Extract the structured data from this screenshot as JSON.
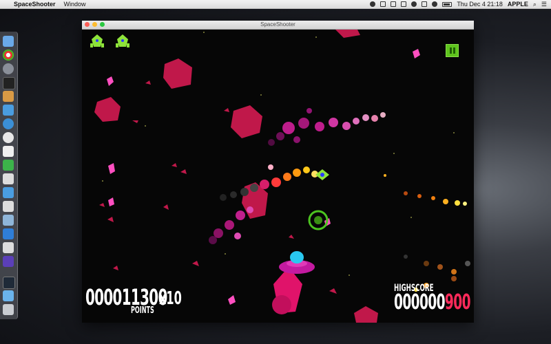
{
  "menubar": {
    "app_name": "SpaceShooter",
    "menu_window": "Window",
    "clock": "Thu Dec 4  21:18",
    "user": "APPLE"
  },
  "window": {
    "title": "SpaceShooter"
  },
  "hud": {
    "score": "000011300",
    "multiplier": "x10",
    "points_label": "POINTS",
    "highscore_label": "HIGHSCORE",
    "highscore_prefix": "000000",
    "highscore_suffix": "900",
    "lives": 2
  },
  "colors": {
    "lives_ship": "#8ee33a",
    "pause_button": "#5fc41e",
    "asteroid": "#c0184a",
    "highscore_accent": "#ff2a5a",
    "player_ship_dome": "#29c8f0"
  },
  "icons": {
    "dock": [
      "finder-icon",
      "chrome-icon",
      "launchpad-icon",
      "terminal-icon",
      "app-icon",
      "xcode-icon",
      "safari-icon",
      "penguin-icon",
      "pages-icon",
      "evernote-icon",
      "unity-icon",
      "xcode-icon",
      "unity-icon",
      "mail-icon",
      "word-icon",
      "unity-icon",
      "game-icon",
      "monitor-icon",
      "folder-icon",
      "trash-icon"
    ]
  }
}
